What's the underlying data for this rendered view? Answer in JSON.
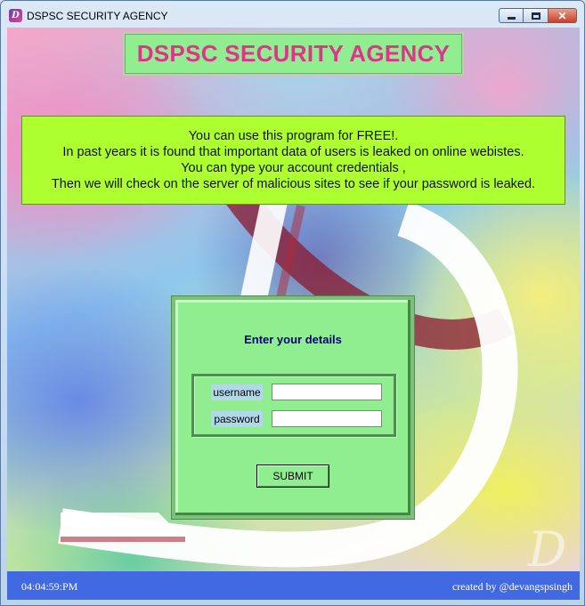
{
  "window": {
    "title": "DSPSC SECURITY AGENCY",
    "icon": "app-logo-icon",
    "controls": {
      "minimize": "minimize-icon",
      "maximize": "maximize-icon",
      "close": "close-icon"
    }
  },
  "banner": {
    "text": "DSPSC SECURITY AGENCY",
    "color": "#e0338c",
    "background": "#90ee90"
  },
  "info": {
    "lines": [
      "You can use this program for FREE!.",
      "In past years it is found that important data of users is leaked on online webistes.",
      "You can type your account credentials ,",
      "Then we will check on the server of malicious sites to see if your password is leaked."
    ],
    "background": "#adff2f"
  },
  "form": {
    "title": "Enter your details",
    "username_label": "username",
    "username_value": "",
    "password_label": "password",
    "password_value": "",
    "submit_label": "SUBMIT",
    "background": "#90ee90",
    "title_color": "#000080"
  },
  "status": {
    "time": "04:04:59:PM",
    "credit": "created by @devangspsingh",
    "background": "#4169e1"
  }
}
